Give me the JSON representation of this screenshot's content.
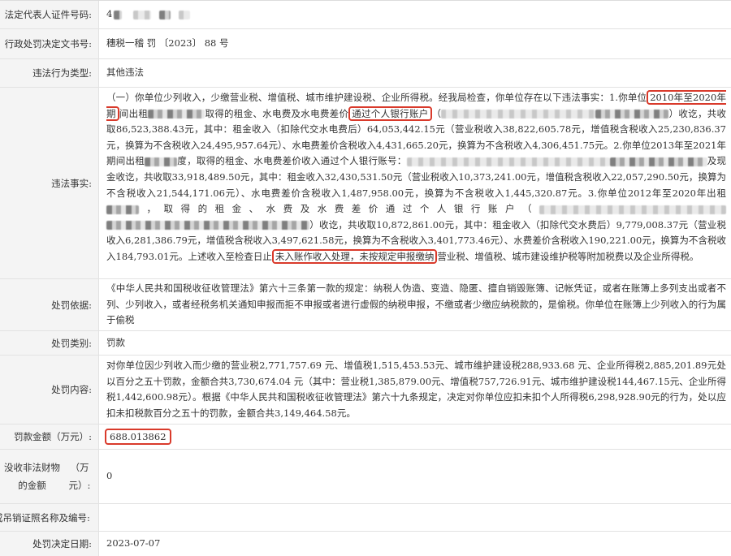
{
  "rows": {
    "legal_id": {
      "label": "法定代表人证件号码:",
      "value_prefix": "4"
    },
    "doc_no": {
      "label": "行政处罚决定文书号:",
      "value": "穗税一稽 罚 〔2023〕 88 号"
    },
    "violation_type": {
      "label": "违法行为类型:",
      "value": "其他违法"
    },
    "facts": {
      "label": "违法事实:",
      "p1": "（一）你单位少列收入，少缴营业税、增值税、城市维护建设税、企业所得税。经我局检查，你单位存在以下违法事实：1.你单位",
      "hl1": "2010年至2020年期",
      "p2": "间出租",
      "p3": "取得的租金、水电费及水电费差价",
      "hl2": "通过个人银行账户",
      "p4": "（",
      "p5": "）收讫，共收取86,523,388.43元，其中：租金收入（扣除代交水电费后）64,053,442.15元（营业税收入38,822,605.78元，增值税含税收入25,230,836.37元，换算为不含税收入24,495,957.64元）、水电费差价含税收入4,431,665.20元，换算为不含税收入4,306,451.75元。2.你单位2013年至2021年期间出租",
      "p6": "度，取得的租金、水电费差价收入通过个人银行账号：",
      "p7": "及现金收讫，共收取33,918,489.50元，其中：租金收入32,430,531.50元（营业税收入10,373,241.00元，增值税含税收入22,057,290.50元，换算为不含税收入21,544,171.06元）、水电费差价含税收入1,487,958.00元，换算为不含税收入1,445,320.87元。3.你单位2012年至2020年出租",
      "p8": "，取得的租金、水费及水费差价通过个人银行账户（",
      "p9": "）收讫，共收取10,872,861.00元，其中：租金收入（扣除代交水费后）9,779,008.37元（营业税收入6,281,386.79元，增值税含税收入3,497,621.58元，换算为不含税收入3,401,773.46元）、水费差价含税收入190,221.00元，换算为不含税收入184,793.01元。上述收入至检查日止",
      "hl3": "未入账作收入处理，未按规定申报缴纳",
      "p10": "营业税、增值税、城市建设维护税等附加税费以及企业所得税。"
    },
    "basis": {
      "label": "处罚依据:",
      "value": "《中华人民共和国税收征收管理法》第六十三条第一款的规定：纳税人伪造、变造、隐匿、擅自销毁账簿、记帐凭证，或者在账簿上多列支出或者不列、少列收入，或者经税务机关通知申报而拒不申报或者进行虚假的纳税申报，不缴或者少缴应纳税款的，是偷税。你单位在账簿上少列收入的行为属于偷税"
    },
    "category": {
      "label": "处罚类别:",
      "value": "罚款"
    },
    "content": {
      "label": "处罚内容:",
      "value": "对你单位因少列收入而少缴的营业税2,771,757.69 元、增值税1,515,453.53元、城市维护建设税288,933.68 元、企业所得税2,885,201.89元处以百分之五十罚款，金额合共3,730,674.04 元（其中：营业税1,385,879.00元、增值税757,726.91元、城市维护建设税144,467.15元、企业所得税1,442,600.98元）。根据《中华人民共和国税收征收管理法》第六十九条规定，决定对你单位应扣未扣个人所得税6,298,928.90元的行为，处以应扣未扣税款百分之五十的罚款，金额合共3,149,464.58元。"
    },
    "amount": {
      "label": "罚款金额（万元）:",
      "value": "688.013862"
    },
    "confiscation": {
      "label_l1": "没收非法财物的金额",
      "label_l2": "（万元）:",
      "value": "0"
    },
    "license": {
      "label": "或吊销证照名称及编号:",
      "value": ""
    },
    "date": {
      "label": "处罚决定日期:",
      "value": "2023-07-07"
    }
  }
}
